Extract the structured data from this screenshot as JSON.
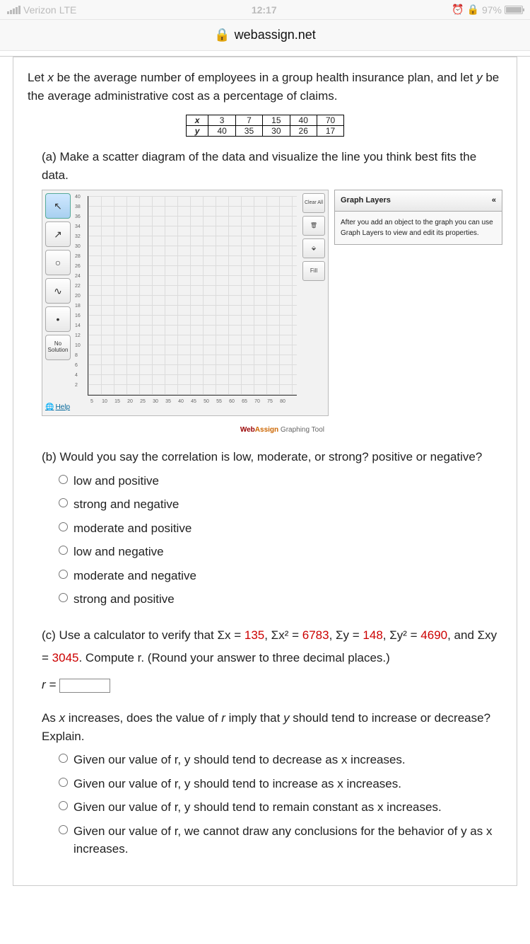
{
  "status": {
    "carrier": "Verizon",
    "network": "LTE",
    "time": "12:17",
    "alarm": true,
    "battery_pct": "97%"
  },
  "browser": {
    "domain": "webassign.net",
    "secure": true
  },
  "intro": {
    "line": "Let x be the average number of employees in a group health insurance plan, and let y be the average administrative cost as a percentage of claims."
  },
  "chart_data": {
    "type": "table",
    "headers": [
      "x",
      "y"
    ],
    "rows": [
      {
        "x": 3,
        "y": 40
      },
      {
        "x": 7,
        "y": 35
      },
      {
        "x": 15,
        "y": 30
      },
      {
        "x": 40,
        "y": 26
      },
      {
        "x": 70,
        "y": 17
      }
    ]
  },
  "part_a": {
    "text": "(a) Make a scatter diagram of the data and visualize the line you think best fits the data."
  },
  "graph": {
    "tools": {
      "pointer": "↖",
      "line": "↗",
      "circle": "○",
      "parabola": "∿",
      "point": "•",
      "no_solution": "No Solution"
    },
    "help": "Help",
    "y_ticks": [
      "40",
      "38",
      "36",
      "34",
      "32",
      "30",
      "28",
      "26",
      "24",
      "22",
      "20",
      "18",
      "16",
      "14",
      "12",
      "10",
      "8",
      "6",
      "4",
      "2"
    ],
    "x_ticks": [
      "5",
      "10",
      "15",
      "20",
      "25",
      "30",
      "35",
      "40",
      "45",
      "50",
      "55",
      "60",
      "65",
      "70",
      "75",
      "80"
    ],
    "side": {
      "clear": "Clear All",
      "delete": "🗑",
      "fill_icon": "⬙",
      "fill": "Fill"
    },
    "layers": {
      "title": "Graph Layers",
      "collapse": "«",
      "hint": "After you add an object to the graph you can use Graph Layers to view and edit its properties."
    },
    "footer_brand": "WebAssign.",
    "footer_text": " Graphing Tool"
  },
  "part_b": {
    "text": "(b) Would you say the correlation is low, moderate, or strong? positive or negative?",
    "options": [
      "low and positive",
      "strong and negative",
      "moderate and positive",
      "low and negative",
      "moderate and negative",
      "strong and positive"
    ]
  },
  "part_c": {
    "prefix": "(c) Use a calculator to verify that Σx = ",
    "sx": "135",
    "t2": ", Σx² = ",
    "sx2": "6783",
    "t3": ", Σy = ",
    "sy": "148",
    "t4": ", Σy² = ",
    "sy2": "4690",
    "t5": ", and Σxy = ",
    "sxy": "3045",
    "suffix": ". Compute r. (Round your answer to three decimal places.)",
    "r_label": "r = "
  },
  "part_d": {
    "text": "As x increases, does the value of r imply that y should tend to increase or decrease? Explain.",
    "options": [
      "Given our value of r, y should tend to decrease as x increases.",
      "Given our value of r, y should tend to increase as x increases.",
      "Given our value of r, y should tend to remain constant as x increases.",
      "Given our value of r, we cannot draw any conclusions for the behavior of y as x increases."
    ]
  }
}
